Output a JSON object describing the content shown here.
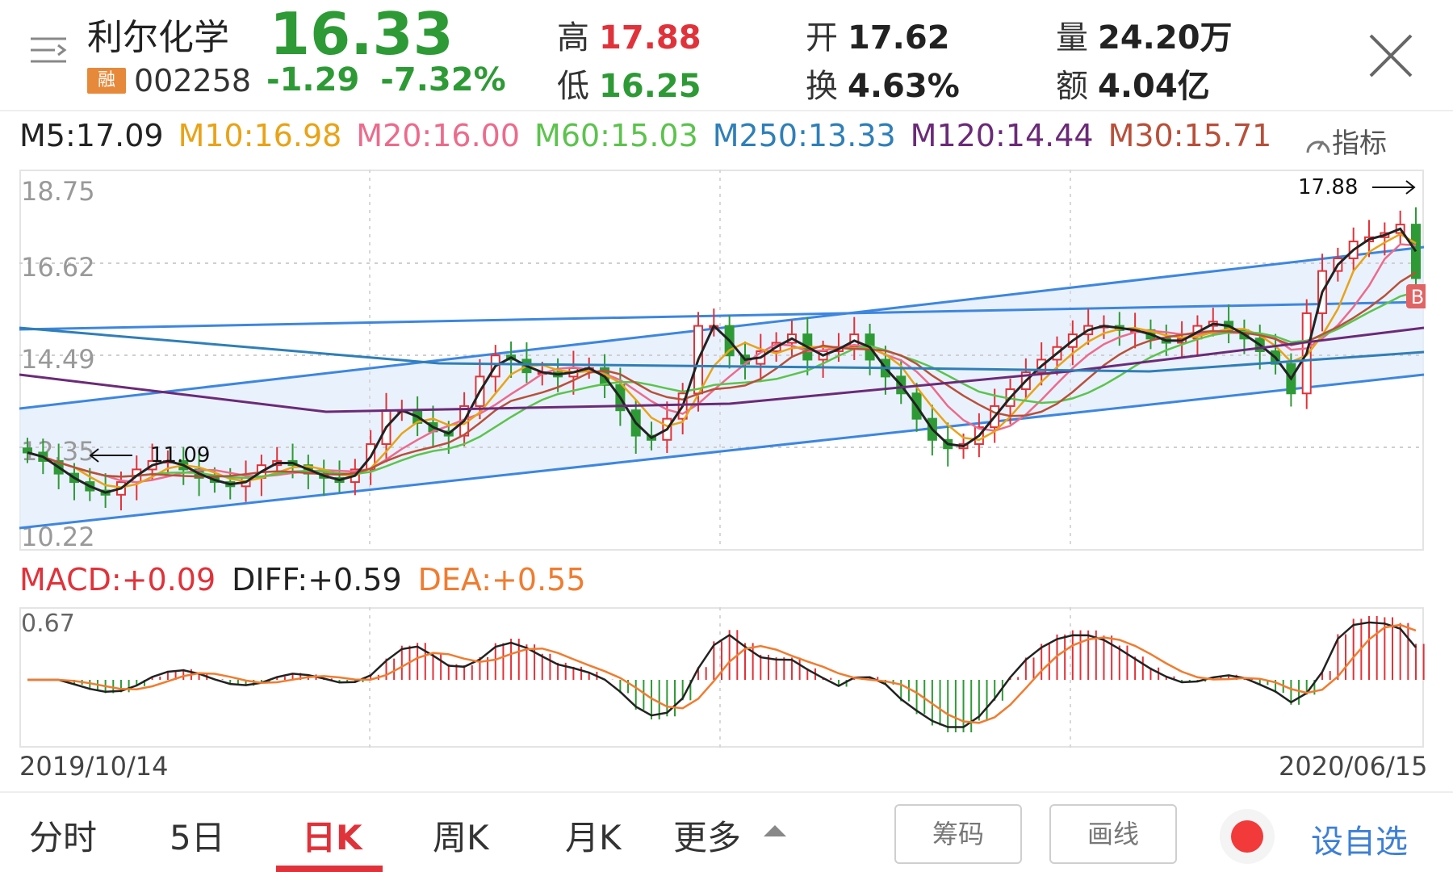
{
  "stock": {
    "name": "利尔化学",
    "badge": "融",
    "code": "002258",
    "price": "16.33",
    "change": "-1.29",
    "change_pct": "-7.32%"
  },
  "quote": {
    "high_label": "高",
    "high": "17.88",
    "low_label": "低",
    "low": "16.25",
    "open_label": "开",
    "open": "17.62",
    "turnover_label": "换",
    "turnover": "4.63%",
    "volume_label": "量",
    "volume": "24.20万",
    "amount_label": "额",
    "amount": "4.04亿"
  },
  "ma": {
    "m5": "M5:17.09",
    "m10": "M10:16.98",
    "m20": "M20:16.00",
    "m60": "M60:15.03",
    "m250": "M250:13.33",
    "m120": "M120:14.44",
    "m30": "M30:15.71"
  },
  "indicator_button": "指标",
  "macd": {
    "macd": "MACD:+0.09",
    "diff": "DIFF:+0.59",
    "dea": "DEA:+0.55",
    "axis_top": "0.67"
  },
  "dates": {
    "start": "2019/10/14",
    "end": "2020/06/15"
  },
  "tabs": {
    "intraday": "分时",
    "five_day": "5日",
    "daily_k": "日K",
    "weekly_k": "周K",
    "monthly_k": "月K",
    "more": "更多"
  },
  "buttons": {
    "chips": "筹码",
    "draw": "画线",
    "add_watch": "设自选"
  },
  "colors": {
    "up": "#e0323a",
    "down": "#2e9a36",
    "m5": "#222222",
    "m10": "#e8a317",
    "m20": "#ec6b8c",
    "m60": "#5cc34d",
    "m250": "#2f7fb8",
    "m120": "#6b2a78",
    "m30": "#b8503a",
    "trend": "#3d86e0"
  },
  "chart_data": {
    "type": "candlestick",
    "title": "",
    "y_ticks": [
      18.75,
      16.62,
      14.49,
      12.35,
      10.22
    ],
    "ylim": [
      10.22,
      18.75
    ],
    "annotations": [
      {
        "text": "17.88",
        "label": "high"
      },
      {
        "text": "11.09",
        "label": "low"
      },
      {
        "text": "B",
        "label": "buy-signal"
      }
    ],
    "x_range": [
      "2019/10/14",
      "2020/06/15"
    ],
    "close_approx": [
      12.2,
      12.0,
      11.7,
      11.5,
      11.3,
      11.2,
      11.5,
      11.8,
      12.0,
      12.0,
      11.8,
      11.6,
      11.5,
      11.4,
      11.6,
      11.9,
      12.0,
      11.9,
      11.7,
      11.6,
      11.5,
      11.8,
      12.4,
      13.2,
      13.2,
      12.9,
      12.7,
      12.6,
      13.3,
      14.0,
      14.5,
      14.4,
      14.1,
      14.1,
      14.0,
      14.2,
      14.2,
      13.8,
      13.2,
      12.6,
      12.5,
      13.0,
      13.6,
      15.2,
      15.2,
      14.5,
      14.3,
      14.6,
      14.8,
      15.0,
      14.4,
      14.6,
      14.7,
      15.0,
      14.4,
      14.0,
      13.6,
      13.0,
      12.5,
      12.3,
      12.4,
      12.8,
      13.3,
      13.7,
      14.1,
      14.4,
      14.7,
      15.0,
      15.2,
      15.2,
      15.1,
      15.1,
      14.9,
      14.8,
      14.9,
      15.2,
      15.3,
      15.1,
      14.9,
      14.6,
      14.3,
      13.6,
      15.5,
      16.5,
      16.8,
      17.2,
      17.3,
      17.4,
      17.6,
      16.33
    ],
    "macd_hist_ylim": [
      -0.67,
      0.67
    ]
  }
}
